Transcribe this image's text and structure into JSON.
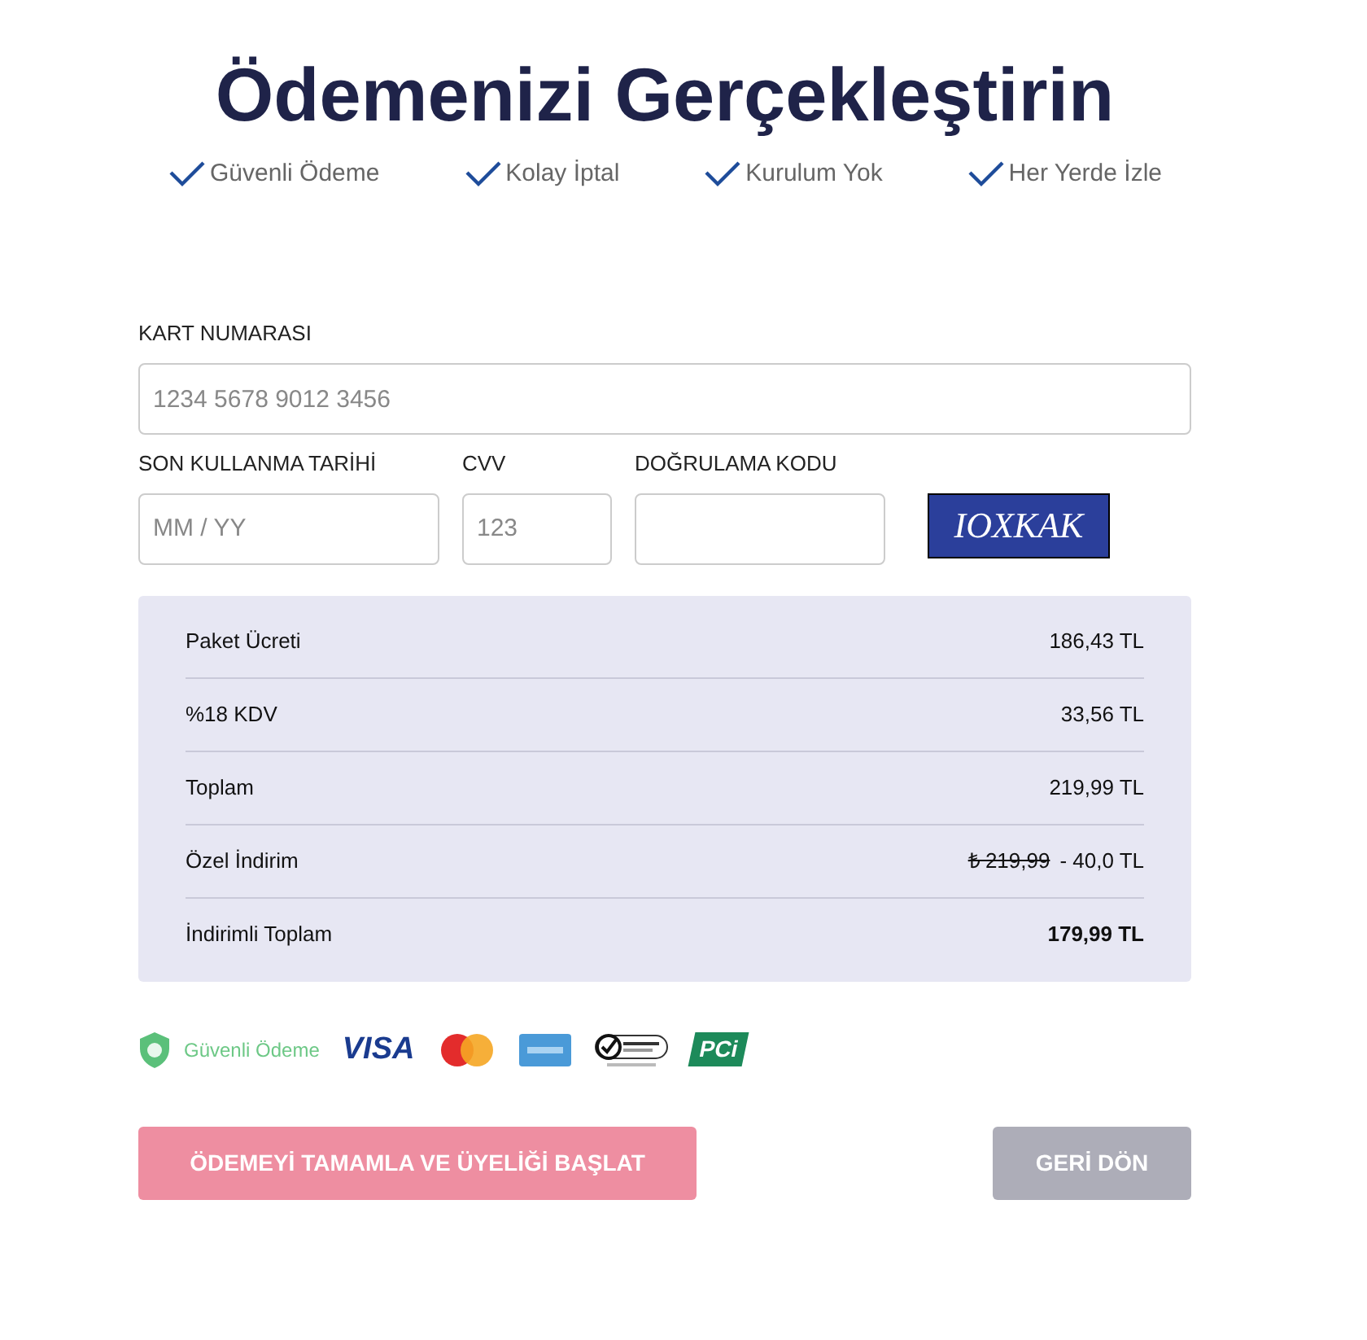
{
  "title": "Ödemenizi Gerçekleştirin",
  "features": [
    "Güvenli Ödeme",
    "Kolay İptal",
    "Kurulum Yok",
    "Her Yerde İzle"
  ],
  "card_number": {
    "label": "KART NUMARASI",
    "placeholder": "1234 5678 9012 3456"
  },
  "expiry": {
    "label": "SON KULLANMA TARİHİ",
    "placeholder": "MM / YY"
  },
  "cvv": {
    "label": "CVV",
    "placeholder": "123"
  },
  "verification": {
    "label": "DOĞRULAMA KODU",
    "captcha": "IOXKAK"
  },
  "summary": [
    {
      "label": "Paket Ücreti",
      "value": "186,43 TL",
      "kind": "plain"
    },
    {
      "label": "%18 KDV",
      "value": "33,56 TL",
      "kind": "plain"
    },
    {
      "label": "Toplam",
      "value": "219,99 TL",
      "kind": "plain"
    },
    {
      "label": "Özel İndirim",
      "old_value": "₺ 219,99",
      "value": "- 40,0 TL",
      "kind": "discount"
    },
    {
      "label": "İndirimli Toplam",
      "value": "179,99 TL",
      "kind": "total"
    }
  ],
  "trust": {
    "secure_label": "Güvenli Ödeme",
    "visa": "VISA",
    "pci": "PCi"
  },
  "buttons": {
    "primary": "ÖDEMEYİ TAMAMLA VE ÜYELİĞİ BAŞLAT",
    "secondary": "GERİ DÖN"
  }
}
